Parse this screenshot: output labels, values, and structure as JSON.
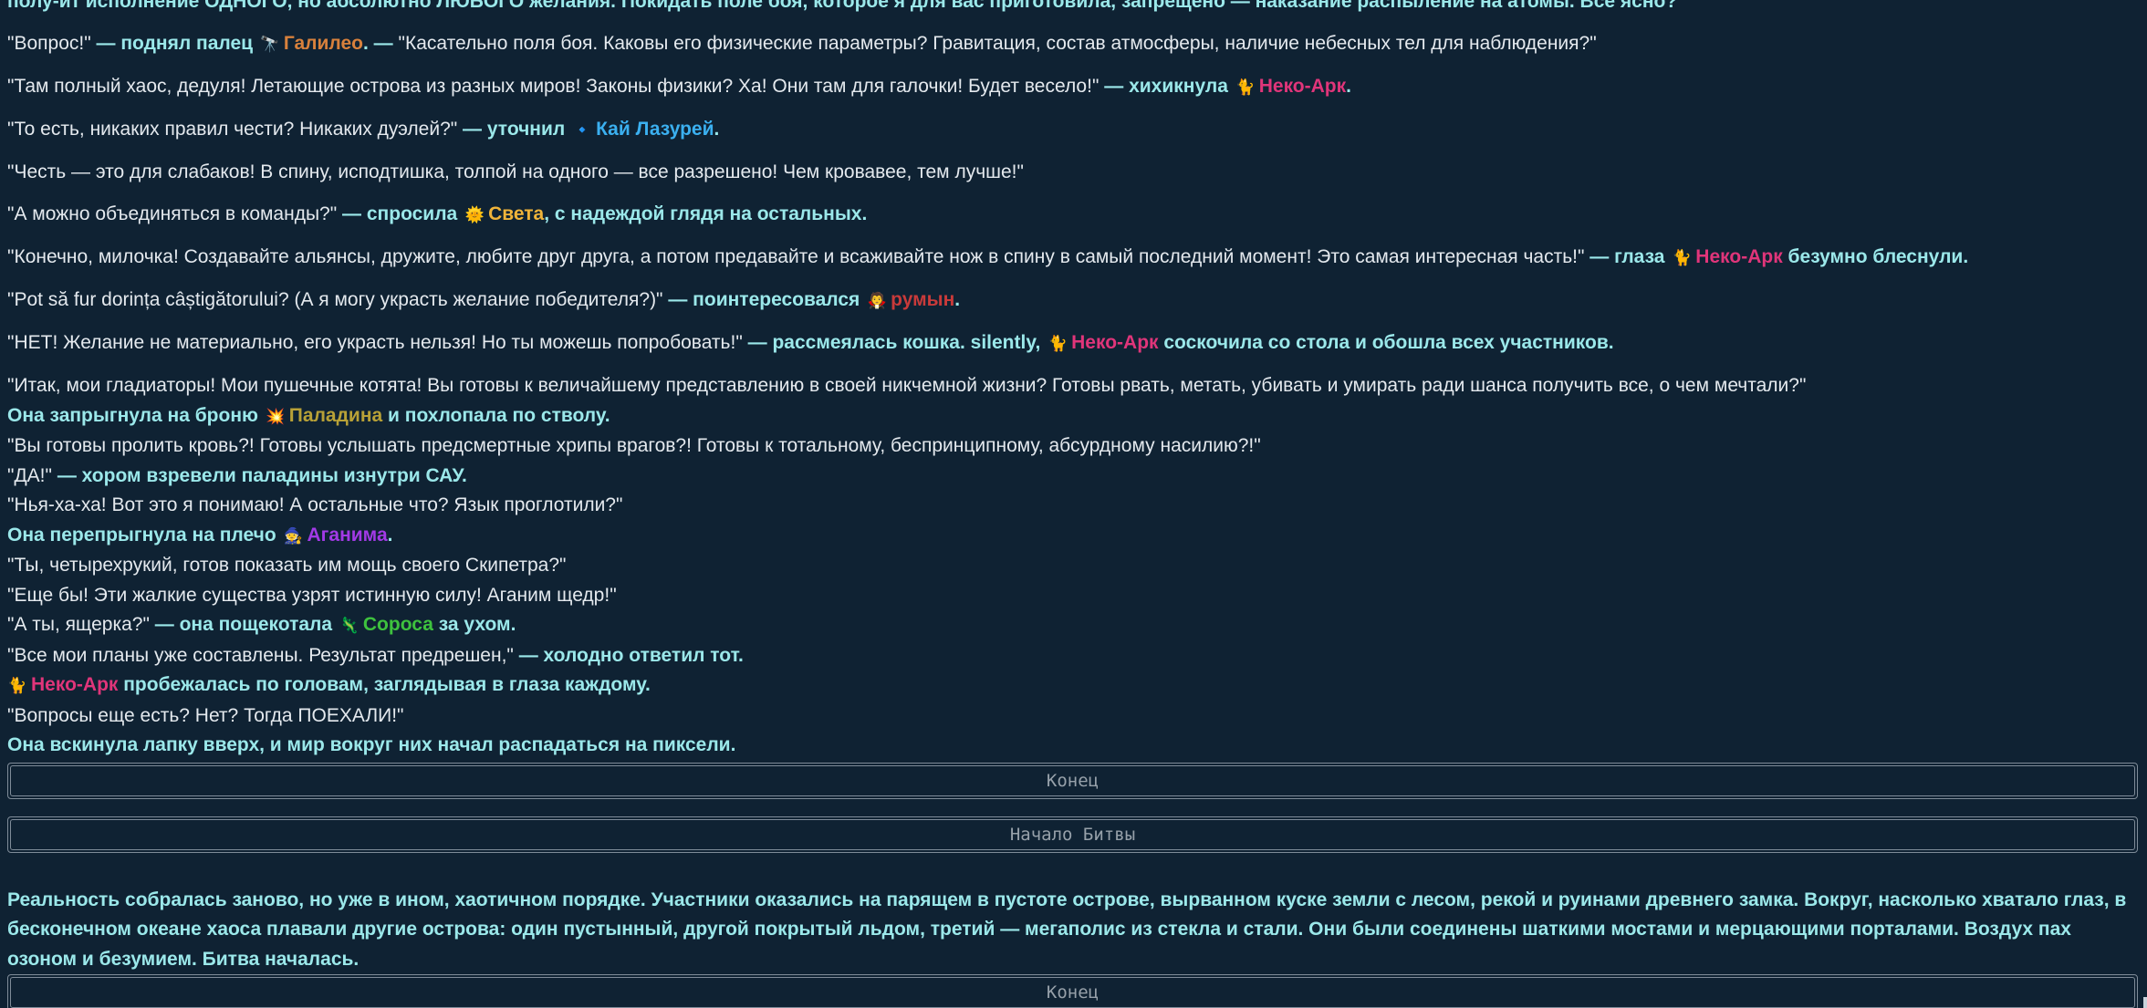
{
  "colors": {
    "background": "#0f2233",
    "speech": "#e4e9ee",
    "narration": "#9be8ea",
    "galileo": "#d8813c",
    "neko": "#e0357a",
    "kai": "#3bb0f0",
    "sveta": "#f0b43a",
    "romanian": "#c93a3a",
    "paladin": "#b8a137",
    "aganim": "#a23ae6",
    "soros": "#3ec23e"
  },
  "log": {
    "top_partial": "полу-ит исполнение ОДНОГО, но абсолютно ЛЮБОГО желания. Покидать поле боя, которое я для вас приготовила, запрещено — наказание распыление на атомы. Все ясно?\"",
    "line1": {
      "q": "\"Вопрос!\"",
      "a1": " — поднял палец ",
      "icon": "telescope-icon",
      "glyph": "🔭",
      "name": "Галилео",
      "a2": ". — ",
      "q2": "\"Касательно поля боя. Каковы его физические параметры? Гравитация, состав атмосферы, наличие небесных тел для наблюдения?\""
    },
    "line2": {
      "q": "\"Там полный хаос, дедуля! Летающие острова из разных миров! Законы физики? Ха! Они там для галочки! Будет весело!\"",
      "a1": " — хихикнула ",
      "icon": "cat-icon",
      "glyph": "🐈",
      "name": "Неко-Арк",
      "a2": "."
    },
    "line3": {
      "q": "\"То есть, никаких правил чести? Никаких дуэлей?\"",
      "a1": " — уточнил ",
      "icon": "orb-icon",
      "glyph": "🔹",
      "name": "Кай Лазурей",
      "a2": "."
    },
    "line4": {
      "q": "\"Честь — это для слабаков! В спину, исподтишка, толпой на одного — все разрешено! Чем кровавее, тем лучше!\""
    },
    "line5": {
      "q": "\"А можно объединяться в команды?\"",
      "a1": " — спросила ",
      "icon": "sun-icon",
      "glyph": "🌞",
      "name": "Света",
      "a2": ", с надеждой глядя на остальных."
    },
    "line6": {
      "q": "\"Конечно, милочка! Создавайте альянсы, дружите, любите друг друга, а потом предавайте и всаживайте нож в спину в самый последний момент! Это самая интересная часть!\"",
      "a1": " — глаза ",
      "icon": "cat-icon",
      "glyph": "🐈",
      "name": "Неко-Арк",
      "a2": " безумно блеснули."
    },
    "line7": {
      "q": "\"Pot să fur dorința câștigătorului? (А я могу украсть желание победителя?)\"",
      "a1": " — поинтересовался ",
      "icon": "vampire-icon",
      "glyph": "🧛",
      "name": "румын",
      "a2": "."
    },
    "line8": {
      "q": "\"НЕТ! Желание не материально, его украсть нельзя! Но ты можешь попробовать!\"",
      "a1": " — рассмеялась кошка. silently, ",
      "icon": "cat-icon",
      "glyph": "🐈",
      "name": "Неко-Арк",
      "a2": " соскочила со стола и обошла всех участников."
    },
    "line9": {
      "q": "\"Итак, мои гладиаторы! Мои пушечные котята! Вы готовы к величайшему представлению в своей никчемной жизни? Готовы рвать, метать, убивать и умирать ради шанса получить все, о чем мечтали?\""
    },
    "line10": {
      "a1": "Она запрыгнула на броню ",
      "icon": "explosion-icon",
      "glyph": "💥",
      "name": "Паладина",
      "a2": " и похлопала по стволу."
    },
    "line11": {
      "q": "\"Вы готовы пролить кровь?! Готовы услышать предсмертные хрипы врагов?! Готовы к тотальному, беспринципному, абсурдному насилию?!\""
    },
    "line12": {
      "q": "\"ДА!\"",
      "a1": " — хором взревели паладины изнутри САУ."
    },
    "line13": {
      "q": "\"Нья-ха-ха! Вот это я понимаю! А остальные что? Язык проглотили?\""
    },
    "line14": {
      "a1": "Она перепрыгнула на плечо ",
      "icon": "mage-icon",
      "glyph": "🧙",
      "name": "Аганима",
      "a2": "."
    },
    "line15": {
      "q": "\"Ты, четырехрукий, готов показать им мощь своего Скипетра?\""
    },
    "line16": {
      "q": "\"Еще бы! Эти жалкие существа узрят истинную силу! Аганим щедр!\""
    },
    "line17": {
      "q": "\"А ты, ящерка?\"",
      "a1": " — она пощекотала ",
      "icon": "lizard-icon",
      "glyph": "🦎",
      "name": "Сороса",
      "a2": " за ухом."
    },
    "line18": {
      "q": "\"Все мои планы уже составлены. Результат предрешен,\"",
      "a1": " — холодно ответил тот."
    },
    "line19": {
      "icon": "cat-icon",
      "glyph": "🐈",
      "name": "Неко-Арк",
      "a2": " пробежалась по головам, заглядывая в глаза каждому."
    },
    "line20": {
      "q": "\"Вопросы еще есть? Нет? Тогда ПОЕХАЛИ!\""
    },
    "line21": {
      "a1": "Она вскинула лапку вверх, и мир вокруг них начал распадаться на пиксели."
    },
    "sep1": "Конец",
    "sep2": "Начало Битвы",
    "para": "Реальность собралась заново, но уже в ином, хаотичном порядке. Участники оказались на парящем в пустоте острове, вырванном куске земли с лесом, рекой и руинами древнего замка. Вокруг, насколько хватало глаз, в бесконечном океане хаоса плавали другие острова: один пустынный, другой покрытый льдом, третий — мегаполис из стекла и стали. Они были соединены шаткими мостами и мерцающими порталами. Воздух пах озоном и безумием. Битва началась.",
    "sep3": "Конец"
  }
}
